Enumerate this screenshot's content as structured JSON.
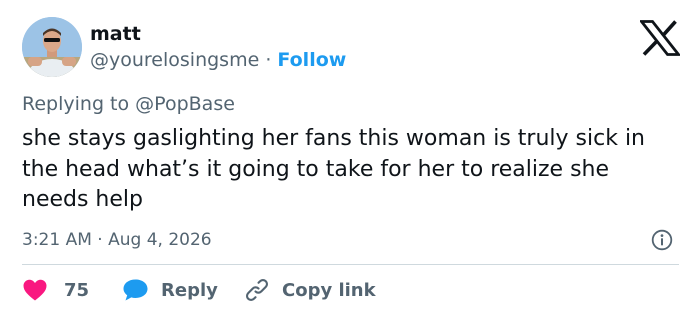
{
  "user": {
    "name": "matt",
    "handle": "@yourelosingsme",
    "separator": "·",
    "follow_label": "Follow"
  },
  "reply_context": {
    "prefix": "Replying to",
    "mention": "@PopBase"
  },
  "tweet": {
    "text": "she stays gaslighting her fans this woman is truly sick in the head what’s it going to take for her to realize she needs help",
    "time": "3:21 AM",
    "separator": "·",
    "date": "Aug 4, 2026"
  },
  "actions": {
    "like_count": "75",
    "reply_label": "Reply",
    "copy_label": "Copy link"
  },
  "colors": {
    "like": "#f91880",
    "reply": "#1d9bf0",
    "follow": "#1d9bf0",
    "secondary_text": "#536471"
  },
  "icons": {
    "brand": "x-logo-icon",
    "info": "info-icon",
    "like": "heart-icon",
    "reply": "speech-bubble-icon",
    "copy": "link-icon"
  }
}
